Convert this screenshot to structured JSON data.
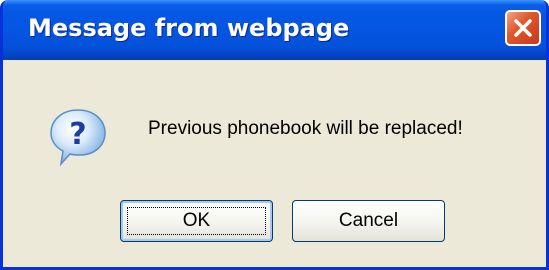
{
  "dialog": {
    "title": "Message from webpage",
    "message": "Previous phonebook will be replaced!",
    "icon": "question-icon",
    "buttons": {
      "ok_label": "OK",
      "cancel_label": "Cancel"
    },
    "close_icon": "close-icon"
  },
  "colors": {
    "titlebar": "#0555e3",
    "dialog_background": "#ece9d8",
    "close_button": "#e0582d",
    "border": "#0831d9"
  }
}
